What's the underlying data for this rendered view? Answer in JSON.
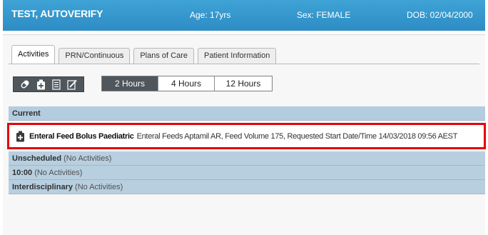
{
  "patient": {
    "name": "TEST, AUTOVERIFY",
    "age": "Age: 17yrs",
    "sex": "Sex: FEMALE",
    "dob": "DOB: 02/04/2000"
  },
  "tabs": [
    {
      "label": "Activities",
      "active": true
    },
    {
      "label": "PRN/Continuous",
      "active": false
    },
    {
      "label": "Plans of Care",
      "active": false
    },
    {
      "label": "Patient Information",
      "active": false
    }
  ],
  "toolbar": {
    "icons": [
      "pill-icon",
      "med-bag-icon",
      "document-icon",
      "edit-icon"
    ]
  },
  "time_ranges": [
    {
      "label": "2 Hours",
      "active": true
    },
    {
      "label": "4 Hours",
      "active": false
    },
    {
      "label": "12 Hours",
      "active": false
    }
  ],
  "sections": {
    "current": {
      "label": "Current"
    },
    "activity": {
      "title": "Enteral Feed Bolus Paediatric",
      "detail": "Enteral Feeds Aptamil AR, Feed Volume 175, Requested Start Date/Time 14/03/2018 09:56 AEST",
      "highlight_color": "#e5000b"
    },
    "unscheduled": {
      "label": "Unscheduled",
      "note": "(No Activities)"
    },
    "slot_1000": {
      "label": "10:00",
      "note": "(No Activities)"
    },
    "interdisciplinary": {
      "label": "Interdisciplinary",
      "note": "(No Activities)"
    }
  },
  "colors": {
    "banner": "#2d8cc4",
    "section_header": "#b8cfe0",
    "active_segment": "#4f565c"
  }
}
